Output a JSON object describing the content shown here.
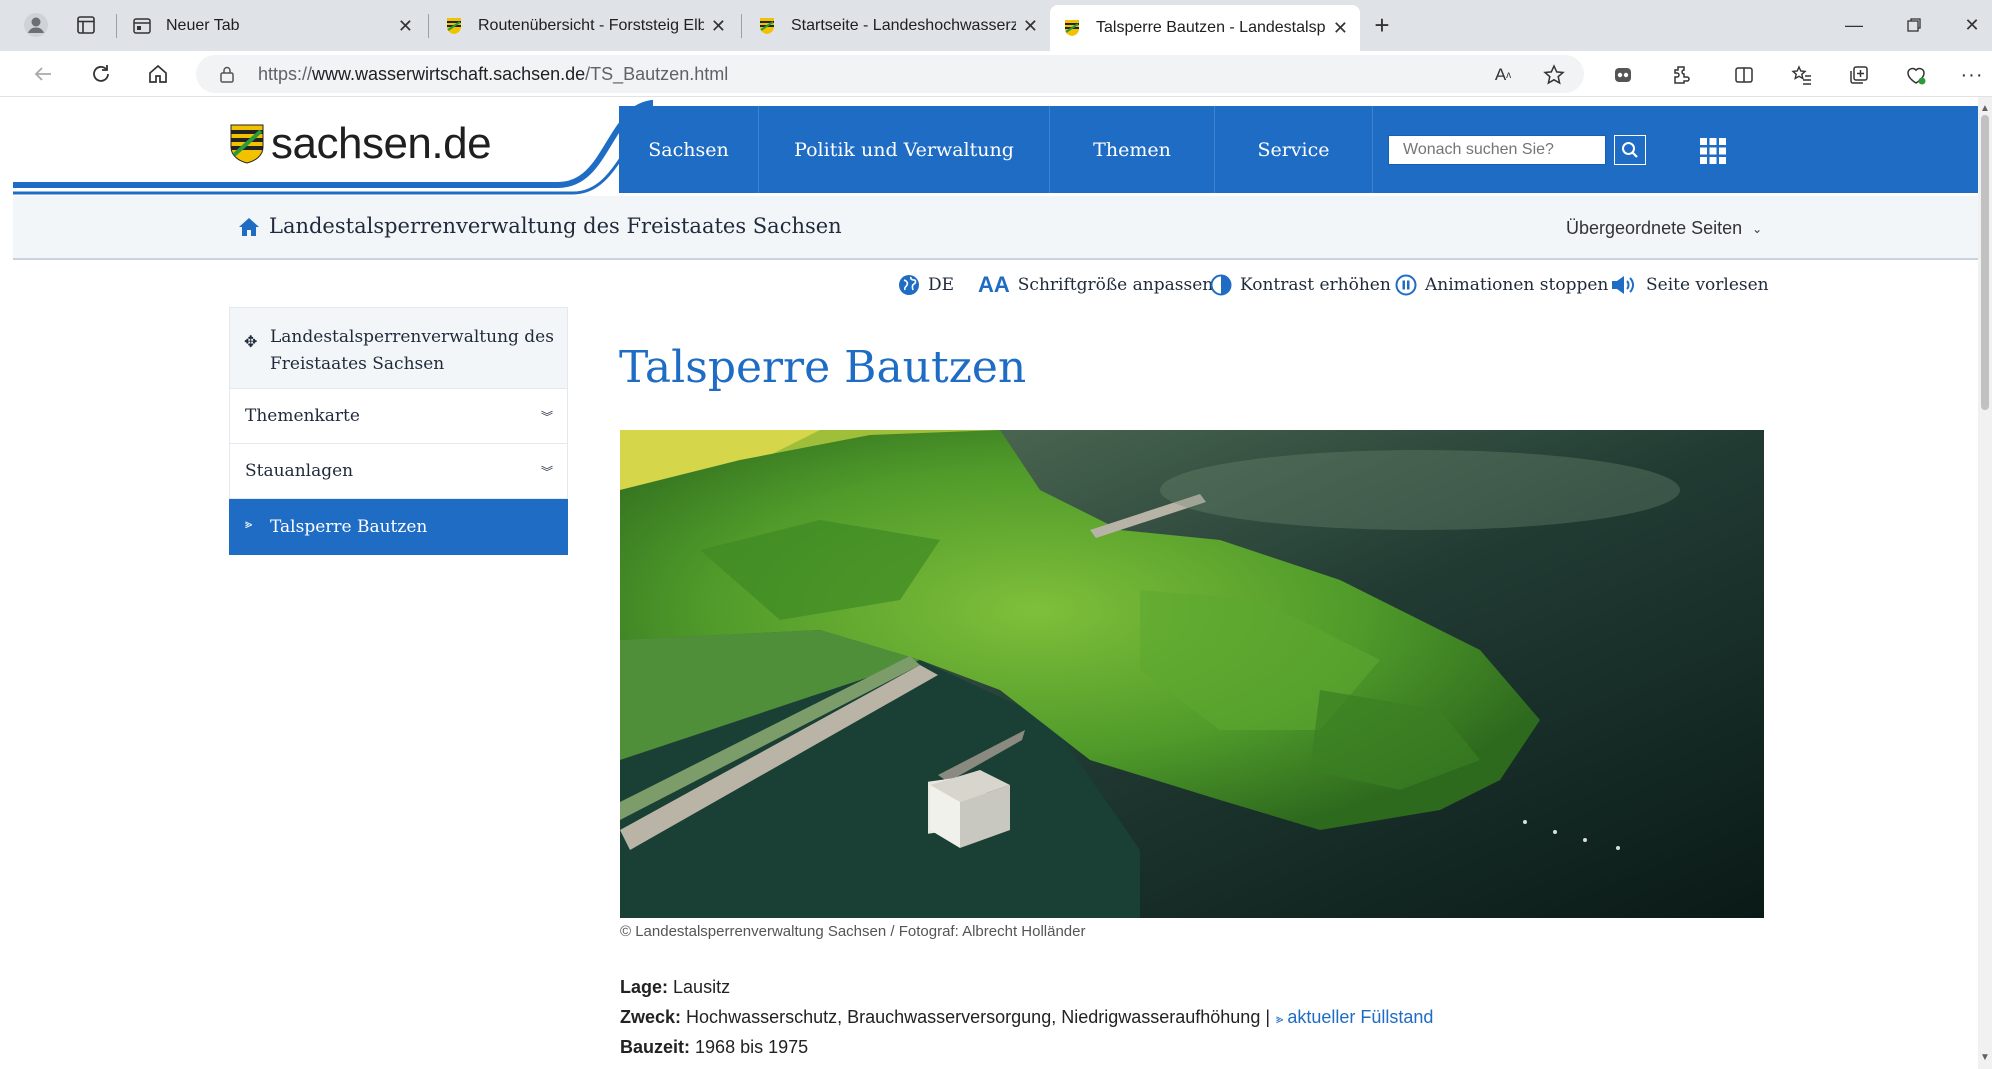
{
  "browser": {
    "tabs": [
      {
        "title": "Neuer Tab",
        "icon": "new-tab-icon"
      },
      {
        "title": "Routenübersicht - Forststeig Elbsandstein",
        "icon": "saxony-crest-icon"
      },
      {
        "title": "Startseite - Landeshochwasserzentrum",
        "icon": "saxony-crest-icon"
      },
      {
        "title": "Talsperre Bautzen - Landestalsperrenverwaltung",
        "icon": "saxony-crest-icon",
        "active": true
      }
    ],
    "url_prefix": "https://",
    "url_domain": "www.wasserwirtschaft.sachsen.de",
    "url_path": "/TS_Bautzen.html"
  },
  "site": {
    "logo_text": "sachsen.de",
    "nav": [
      "Sachsen",
      "Politik und Verwaltung",
      "Themen",
      "Service"
    ],
    "search_placeholder": "Wonach suchen Sie?",
    "accent_color": "#1f6cc5"
  },
  "breadcrumb": {
    "title": "Landestalsperrenverwaltung des Freistaates Sachsen",
    "parent_pages": "Übergeordnete Seiten"
  },
  "a11y": {
    "language": "DE",
    "font_size": "Schriftgröße anpassen",
    "contrast": "Kontrast erhöhen",
    "animations": "Animationen stoppen",
    "read_aloud": "Seite vorlesen"
  },
  "subnav": {
    "top": "Landestalsperrenverwaltung des Freistaates Sachsen",
    "items": [
      "Themenkarte",
      "Stauanlagen"
    ],
    "active": "Talsperre Bautzen"
  },
  "main": {
    "title": "Talsperre Bautzen",
    "caption": "© Landestalsperrenverwaltung Sachsen / Fotograf: Albrecht Holländer",
    "facts": {
      "lage_label": "Lage:",
      "lage_value": "Lausitz",
      "zweck_label": "Zweck:",
      "zweck_value": "Hochwasserschutz, Brauchwasserversorgung, Niedrigwasseraufhöhung |",
      "zweck_link": "aktueller Füllstand",
      "bauzeit_label": "Bauzeit:",
      "bauzeit_value": "1968 bis 1975"
    }
  }
}
